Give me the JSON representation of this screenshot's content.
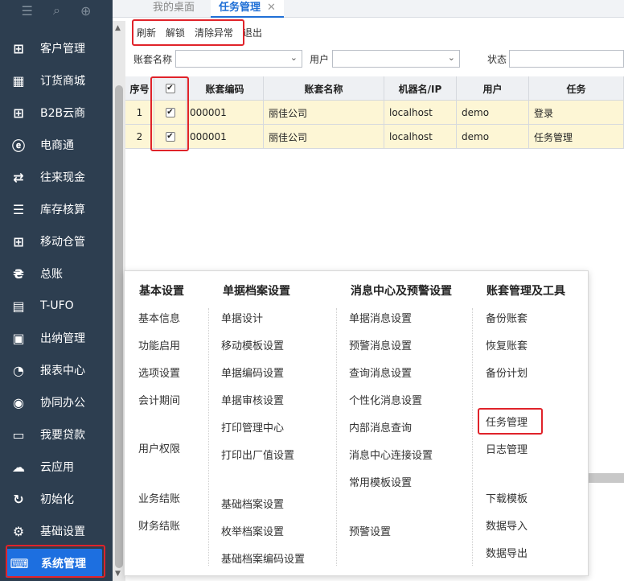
{
  "sidebar": {
    "top_icons": [
      "menu-icon",
      "search-icon",
      "add-icon"
    ],
    "items": [
      {
        "label": "客户管理",
        "icon": "crm-icon",
        "glyph": "⊞"
      },
      {
        "label": "订货商城",
        "icon": "mall-icon",
        "glyph": "▦"
      },
      {
        "label": "B2B云商",
        "icon": "b2b-icon",
        "glyph": "⊞"
      },
      {
        "label": "电商通",
        "icon": "ecommerce-icon",
        "glyph": "ⓔ"
      },
      {
        "label": "往来现金",
        "icon": "cash-icon",
        "glyph": "⇄"
      },
      {
        "label": "库存核算",
        "icon": "inventory-icon",
        "glyph": "☰"
      },
      {
        "label": "移动仓管",
        "icon": "mobile-warehouse-icon",
        "glyph": "⊞"
      },
      {
        "label": "总账",
        "icon": "ledger-icon",
        "glyph": "₴"
      },
      {
        "label": "T-UFO",
        "icon": "ufo-icon",
        "glyph": "▤"
      },
      {
        "label": "出纳管理",
        "icon": "cashier-icon",
        "glyph": "▣"
      },
      {
        "label": "报表中心",
        "icon": "report-icon",
        "glyph": "◔"
      },
      {
        "label": "协同办公",
        "icon": "collab-icon",
        "glyph": "◉"
      },
      {
        "label": "我要贷款",
        "icon": "loan-icon",
        "glyph": "▭"
      },
      {
        "label": "云应用",
        "icon": "cloud-icon",
        "glyph": "☁"
      },
      {
        "label": "初始化",
        "icon": "init-icon",
        "glyph": "↻"
      },
      {
        "label": "基础设置",
        "icon": "settings-icon",
        "glyph": "⚙"
      },
      {
        "label": "系统管理",
        "icon": "system-icon",
        "glyph": "⌨",
        "active": true
      }
    ]
  },
  "tabs": [
    {
      "label": "我的桌面"
    },
    {
      "label": "任务管理",
      "active": true
    }
  ],
  "toolbar": {
    "refresh": "刷新",
    "unlock": "解锁",
    "clear_error": "清除异常",
    "exit": "退出"
  },
  "filters": {
    "account_label": "账套名称",
    "user_label": "用户",
    "status_label": "状态"
  },
  "grid": {
    "headers": [
      "序号",
      "",
      "账套编码",
      "账套名称",
      "机器名/IP",
      "用户",
      "任务"
    ],
    "rows": [
      {
        "seq": "1",
        "checked": true,
        "code": "000001",
        "name": "丽佳公司",
        "machine": "localhost",
        "user": "demo",
        "task": "登录"
      },
      {
        "seq": "2",
        "checked": true,
        "code": "000001",
        "name": "丽佳公司",
        "machine": "localhost",
        "user": "demo",
        "task": "任务管理"
      }
    ]
  },
  "menu": {
    "col1": {
      "title": "基本设置",
      "items": [
        "基本信息",
        "功能启用",
        "选项设置",
        "会计期间",
        "用户权限",
        "业务结账",
        "财务结账"
      ]
    },
    "col2": {
      "title": "单据档案设置",
      "items": [
        "单据设计",
        "移动模板设置",
        "单据编码设置",
        "单据审核设置",
        "打印管理中心",
        "打印出厂值设置",
        "基础档案设置",
        "枚举档案设置",
        "基础档案编码设置"
      ]
    },
    "col3": {
      "title": "消息中心及预警设置",
      "items": [
        "单据消息设置",
        "预警消息设置",
        "查询消息设置",
        "个性化消息设置",
        "内部消息查询",
        "消息中心连接设置",
        "常用模板设置",
        "预警设置"
      ]
    },
    "col4": {
      "title": "账套管理及工具",
      "items": [
        "备份账套",
        "恢复账套",
        "备份计划",
        "任务管理",
        "日志管理",
        "下载模板",
        "数据导入",
        "数据导出"
      ]
    }
  },
  "colors": {
    "sidebar_bg": "#2d3e50",
    "active_blue": "#1d6fe0",
    "highlight_red": "#e0232a",
    "row_yellow": "#fdf6d5"
  }
}
